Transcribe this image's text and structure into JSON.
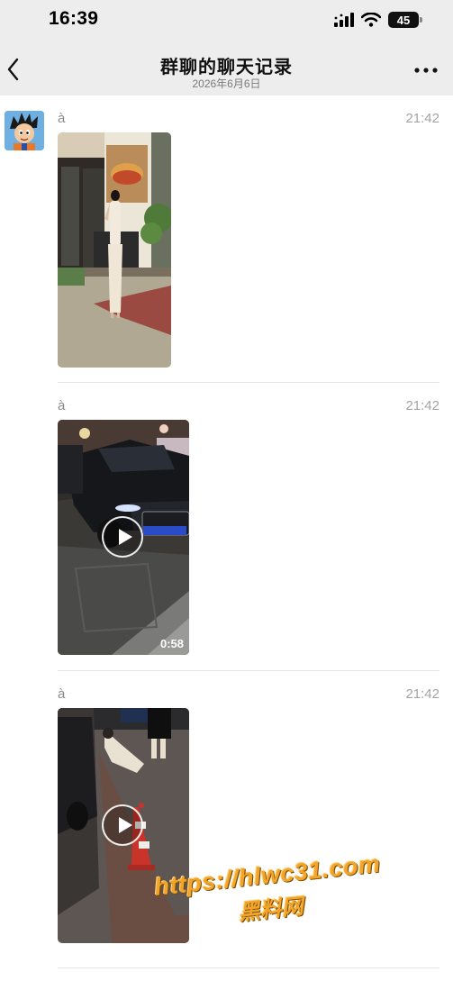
{
  "status_bar": {
    "time": "16:39",
    "battery": "45"
  },
  "header": {
    "title": "群聊的聊天记录",
    "subtitle": "2026年6月6日"
  },
  "messages": [
    {
      "sender": "à",
      "time": "21:42",
      "type": "image",
      "media_label": "image-photo"
    },
    {
      "sender": "à",
      "time": "21:42",
      "type": "video",
      "duration": "0:58"
    },
    {
      "sender": "à",
      "time": "21:42",
      "type": "video",
      "duration": ""
    }
  ],
  "watermark": {
    "line1": "https://hlwc31.com",
    "line2": "黑料网"
  },
  "icons": {
    "back": "chevron-left-icon",
    "more": "more-dots-icon",
    "play": "play-icon",
    "signal": "signal-icon",
    "wifi": "wifi-icon",
    "battery": "battery-icon"
  },
  "colors": {
    "header_bg": "#ededed",
    "watermark": "#f2a52b"
  }
}
